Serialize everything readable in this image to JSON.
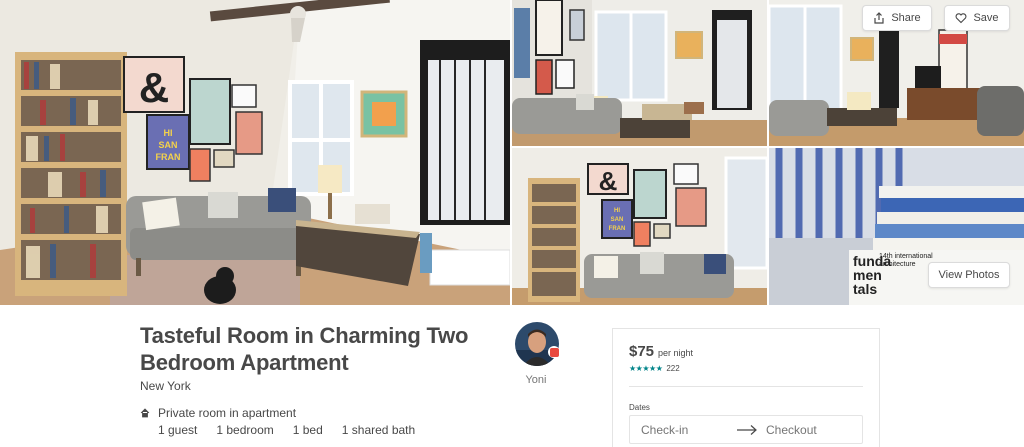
{
  "gallery": {
    "share_label": "Share",
    "save_label": "Save",
    "view_photos_label": "View Photos",
    "photos": [
      {
        "id": "main",
        "poster_lines": [
          "HI",
          "SAN",
          "FRAN"
        ],
        "ampersand": "&"
      },
      {
        "id": "top-left"
      },
      {
        "id": "top-right"
      },
      {
        "id": "bottom-left",
        "poster_lines": [
          "HI",
          "SAN",
          "FRAN"
        ],
        "ampersand": "&"
      },
      {
        "id": "bottom-right",
        "book_spine": [
          "funda",
          "men",
          "tals"
        ],
        "book_cover_lines": [
          "14th international",
          "architecture"
        ]
      }
    ]
  },
  "listing": {
    "title": "Tasteful Room in Charming Two Bedroom Apartment",
    "location": "New York",
    "room_type": "Private room in apartment",
    "specs": [
      "1 guest",
      "1 bedroom",
      "1 bed",
      "1 shared bath"
    ]
  },
  "host": {
    "name": "Yoni"
  },
  "booking": {
    "price": "$75",
    "per_night": "per night",
    "stars": "★★★★★",
    "review_count": "222",
    "dates_label": "Dates",
    "checkin_placeholder": "Check-in",
    "checkout_placeholder": "Checkout"
  },
  "colors": {
    "accent": "#008489",
    "text": "#484848",
    "muted": "#767676",
    "border": "#e4e4e4",
    "badge": "#e8483e"
  },
  "icons": {
    "share": "share-icon",
    "save": "heart-icon",
    "room_type": "home-icon",
    "date_arrow": "arrow-right-icon"
  }
}
